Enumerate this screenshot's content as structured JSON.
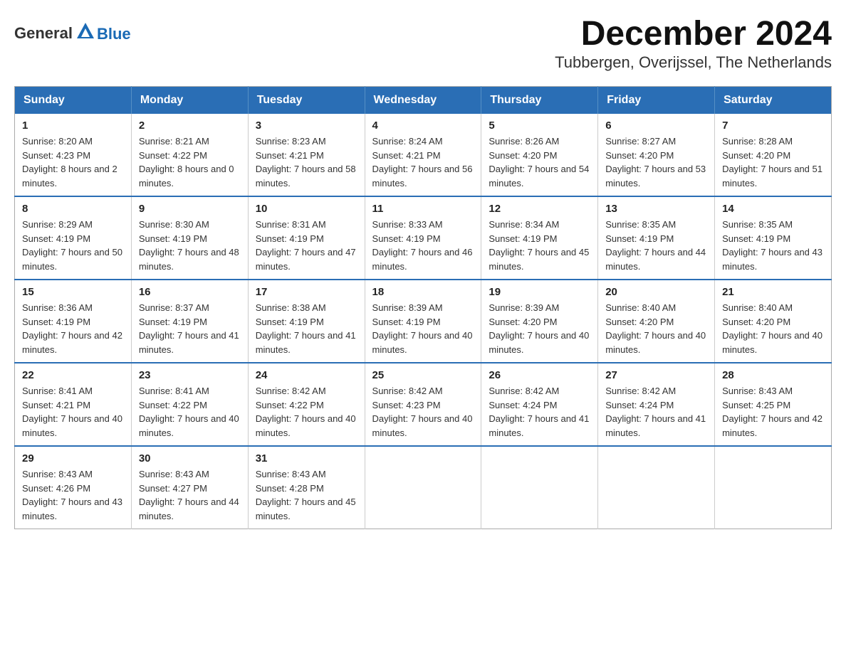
{
  "logo": {
    "general": "General",
    "blue": "Blue"
  },
  "title": "December 2024",
  "location": "Tubbergen, Overijssel, The Netherlands",
  "weekdays": [
    "Sunday",
    "Monday",
    "Tuesday",
    "Wednesday",
    "Thursday",
    "Friday",
    "Saturday"
  ],
  "weeks": [
    [
      {
        "day": "1",
        "sunrise": "8:20 AM",
        "sunset": "4:23 PM",
        "daylight": "8 hours and 2 minutes."
      },
      {
        "day": "2",
        "sunrise": "8:21 AM",
        "sunset": "4:22 PM",
        "daylight": "8 hours and 0 minutes."
      },
      {
        "day": "3",
        "sunrise": "8:23 AM",
        "sunset": "4:21 PM",
        "daylight": "7 hours and 58 minutes."
      },
      {
        "day": "4",
        "sunrise": "8:24 AM",
        "sunset": "4:21 PM",
        "daylight": "7 hours and 56 minutes."
      },
      {
        "day": "5",
        "sunrise": "8:26 AM",
        "sunset": "4:20 PM",
        "daylight": "7 hours and 54 minutes."
      },
      {
        "day": "6",
        "sunrise": "8:27 AM",
        "sunset": "4:20 PM",
        "daylight": "7 hours and 53 minutes."
      },
      {
        "day": "7",
        "sunrise": "8:28 AM",
        "sunset": "4:20 PM",
        "daylight": "7 hours and 51 minutes."
      }
    ],
    [
      {
        "day": "8",
        "sunrise": "8:29 AM",
        "sunset": "4:19 PM",
        "daylight": "7 hours and 50 minutes."
      },
      {
        "day": "9",
        "sunrise": "8:30 AM",
        "sunset": "4:19 PM",
        "daylight": "7 hours and 48 minutes."
      },
      {
        "day": "10",
        "sunrise": "8:31 AM",
        "sunset": "4:19 PM",
        "daylight": "7 hours and 47 minutes."
      },
      {
        "day": "11",
        "sunrise": "8:33 AM",
        "sunset": "4:19 PM",
        "daylight": "7 hours and 46 minutes."
      },
      {
        "day": "12",
        "sunrise": "8:34 AM",
        "sunset": "4:19 PM",
        "daylight": "7 hours and 45 minutes."
      },
      {
        "day": "13",
        "sunrise": "8:35 AM",
        "sunset": "4:19 PM",
        "daylight": "7 hours and 44 minutes."
      },
      {
        "day": "14",
        "sunrise": "8:35 AM",
        "sunset": "4:19 PM",
        "daylight": "7 hours and 43 minutes."
      }
    ],
    [
      {
        "day": "15",
        "sunrise": "8:36 AM",
        "sunset": "4:19 PM",
        "daylight": "7 hours and 42 minutes."
      },
      {
        "day": "16",
        "sunrise": "8:37 AM",
        "sunset": "4:19 PM",
        "daylight": "7 hours and 41 minutes."
      },
      {
        "day": "17",
        "sunrise": "8:38 AM",
        "sunset": "4:19 PM",
        "daylight": "7 hours and 41 minutes."
      },
      {
        "day": "18",
        "sunrise": "8:39 AM",
        "sunset": "4:19 PM",
        "daylight": "7 hours and 40 minutes."
      },
      {
        "day": "19",
        "sunrise": "8:39 AM",
        "sunset": "4:20 PM",
        "daylight": "7 hours and 40 minutes."
      },
      {
        "day": "20",
        "sunrise": "8:40 AM",
        "sunset": "4:20 PM",
        "daylight": "7 hours and 40 minutes."
      },
      {
        "day": "21",
        "sunrise": "8:40 AM",
        "sunset": "4:20 PM",
        "daylight": "7 hours and 40 minutes."
      }
    ],
    [
      {
        "day": "22",
        "sunrise": "8:41 AM",
        "sunset": "4:21 PM",
        "daylight": "7 hours and 40 minutes."
      },
      {
        "day": "23",
        "sunrise": "8:41 AM",
        "sunset": "4:22 PM",
        "daylight": "7 hours and 40 minutes."
      },
      {
        "day": "24",
        "sunrise": "8:42 AM",
        "sunset": "4:22 PM",
        "daylight": "7 hours and 40 minutes."
      },
      {
        "day": "25",
        "sunrise": "8:42 AM",
        "sunset": "4:23 PM",
        "daylight": "7 hours and 40 minutes."
      },
      {
        "day": "26",
        "sunrise": "8:42 AM",
        "sunset": "4:24 PM",
        "daylight": "7 hours and 41 minutes."
      },
      {
        "day": "27",
        "sunrise": "8:42 AM",
        "sunset": "4:24 PM",
        "daylight": "7 hours and 41 minutes."
      },
      {
        "day": "28",
        "sunrise": "8:43 AM",
        "sunset": "4:25 PM",
        "daylight": "7 hours and 42 minutes."
      }
    ],
    [
      {
        "day": "29",
        "sunrise": "8:43 AM",
        "sunset": "4:26 PM",
        "daylight": "7 hours and 43 minutes."
      },
      {
        "day": "30",
        "sunrise": "8:43 AM",
        "sunset": "4:27 PM",
        "daylight": "7 hours and 44 minutes."
      },
      {
        "day": "31",
        "sunrise": "8:43 AM",
        "sunset": "4:28 PM",
        "daylight": "7 hours and 45 minutes."
      },
      null,
      null,
      null,
      null
    ]
  ]
}
